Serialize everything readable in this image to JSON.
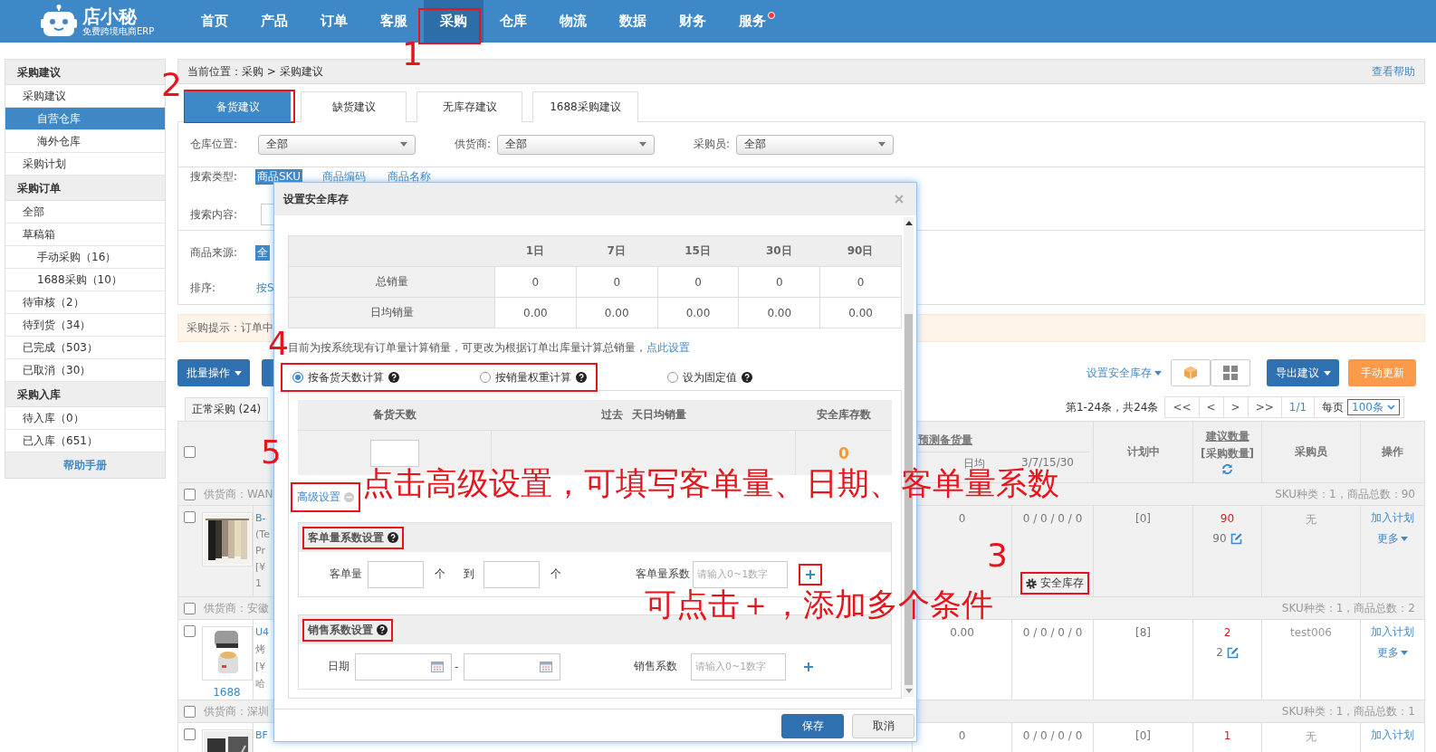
{
  "nav": {
    "logo": "店小秘",
    "tagline": "免费跨境电商ERP",
    "items": [
      {
        "label": "首页",
        "selected": false,
        "badge": false
      },
      {
        "label": "产品",
        "selected": false,
        "badge": false
      },
      {
        "label": "订单",
        "selected": false,
        "badge": false
      },
      {
        "label": "客服",
        "selected": false,
        "badge": false
      },
      {
        "label": "采购",
        "selected": true,
        "badge": false
      },
      {
        "label": "仓库",
        "selected": false,
        "badge": false
      },
      {
        "label": "物流",
        "selected": false,
        "badge": false
      },
      {
        "label": "数据",
        "selected": false,
        "badge": false
      },
      {
        "label": "财务",
        "selected": false,
        "badge": false
      },
      {
        "label": "服务",
        "selected": false,
        "badge": true
      }
    ]
  },
  "sidebar": {
    "sections": [
      {
        "title": "采购建议",
        "items": [
          {
            "label": "采购建议",
            "selected": false,
            "children": [
              {
                "label": "自营仓库",
                "selected": true
              },
              {
                "label": "海外仓库",
                "selected": false
              }
            ]
          },
          {
            "label": "采购计划",
            "selected": false
          }
        ]
      },
      {
        "title": "采购订单",
        "items": [
          {
            "label": "全部",
            "selected": false
          },
          {
            "label": "草稿箱",
            "selected": false,
            "children": [
              {
                "label": "手动采购（16）",
                "selected": false
              },
              {
                "label": "1688采购（10）",
                "selected": false
              }
            ]
          },
          {
            "label": "待审核（2）",
            "selected": false
          },
          {
            "label": "待到货（34）",
            "selected": false
          },
          {
            "label": "已完成（503）",
            "selected": false
          },
          {
            "label": "已取消（30）",
            "selected": false
          }
        ]
      },
      {
        "title": "采购入库",
        "items": [
          {
            "label": "待入库（0）",
            "selected": false
          },
          {
            "label": "已入库（651）",
            "selected": false
          }
        ]
      }
    ],
    "help": "帮助手册"
  },
  "breadcrumb": {
    "text": "当前位置：采购 > 采购建议",
    "help": "查看帮助"
  },
  "tabs": [
    {
      "label": "备货建议",
      "selected": true
    },
    {
      "label": "缺货建议",
      "selected": false
    },
    {
      "label": "无库存建议",
      "selected": false
    },
    {
      "label": "1688采购建议",
      "selected": false
    }
  ],
  "filters": {
    "selects": [
      {
        "label": "仓库位置:",
        "value": "全部"
      },
      {
        "label": "供货商:",
        "value": "全部"
      },
      {
        "label": "采购员:",
        "value": "全部"
      }
    ],
    "search_type": {
      "label": "搜索类型:",
      "options": [
        {
          "label": "商品SKU",
          "selected": true
        },
        {
          "label": "商品编码",
          "selected": false
        },
        {
          "label": "商品名称",
          "selected": false
        }
      ]
    },
    "search_content": {
      "label": "搜索内容:"
    },
    "source": {
      "label": "商品来源:",
      "value": "全"
    },
    "sort": {
      "label": "排序:",
      "value": "按S"
    }
  },
  "tip": "采购提示：订单中",
  "toolbar": {
    "batch": "批量操作",
    "safety_link": "设置安全库存",
    "export": "导出建议",
    "update": "手动更新"
  },
  "list_tabs": [
    {
      "label": "正常采购 (24)",
      "selected": true
    }
  ],
  "pagination": {
    "summary": "第1-24条，共24条",
    "buttons": [
      "<<",
      "<",
      ">",
      ">>"
    ],
    "page": "1/1",
    "per_page_label": "每页",
    "per_page": "100条"
  },
  "table": {
    "header_checked": false,
    "columns": {
      "forecast": "预测备货量",
      "daily": "日均",
      "periods": "3/7/15/30",
      "planned": "计划中",
      "suggested": "建议数量",
      "purchase": "[采购数量]",
      "buyer": "采购员",
      "actions": "操作"
    },
    "groups": [
      {
        "checked": false,
        "supplier": "供货商：WAN",
        "summary": "SKU种类：1，商品总数：90",
        "row": {
          "checked": false,
          "highlighted": true,
          "image": {
            "kind": "picture"
          },
          "product_lines": [
            "B-",
            "(Te",
            "Pr",
            "[¥",
            "1"
          ],
          "daily": "0",
          "periods": "0 / 0 / 0 / 0",
          "safety_button": "安全库存",
          "planned": "[0]",
          "suggested": "90",
          "purchase_qty": "90",
          "buyer": "无",
          "actions": [
            "加入计划",
            "更多"
          ]
        }
      },
      {
        "checked": false,
        "supplier": "供货商：安徽",
        "summary": "SKU种类：1，商品总数：2",
        "row": {
          "checked": false,
          "highlighted": false,
          "image": {
            "kind": "picture"
          },
          "image_caption": "1688",
          "product_lines": [
            "U4",
            "烤",
            "[¥",
            "哈"
          ],
          "daily": "0.00",
          "periods": "0 / 0 / 0 / 0",
          "planned": "[8]",
          "suggested": "2",
          "purchase_qty": "2",
          "buyer": "test006",
          "actions": [
            "加入计划",
            "更多"
          ]
        }
      },
      {
        "checked": false,
        "supplier": "供货商：深圳",
        "summary": "SKU种类：1，商品总数：1",
        "row": {
          "checked": false,
          "highlighted": false,
          "image": {
            "kind": "picture"
          },
          "product_lines": [
            "BF"
          ],
          "daily": "0",
          "periods": "0 / 0 / 0 / 0",
          "planned": "[0]",
          "suggested": "1",
          "buyer": "无",
          "actions": [
            "加入计划"
          ]
        }
      }
    ]
  },
  "dialog": {
    "title": "设置安全库存",
    "sales_table": {
      "columns": [
        "1日",
        "7日",
        "15日",
        "30日",
        "90日"
      ],
      "rows": [
        {
          "label": "总销量",
          "values": [
            "0",
            "0",
            "0",
            "0",
            "0"
          ]
        },
        {
          "label": "日均销量",
          "values": [
            "0.00",
            "0.00",
            "0.00",
            "0.00",
            "0.00"
          ]
        }
      ]
    },
    "note": {
      "text": "目前为按系统现有订单量计算销量，可更改为根据订单出库量计算总销量，",
      "link": "点此设置"
    },
    "methods": [
      {
        "label": "按备货天数计算",
        "selected": true
      },
      {
        "label": "按销量权重计算",
        "selected": false
      },
      {
        "label": "设为固定值",
        "selected": false
      }
    ],
    "calc_table": {
      "days": "备货天数",
      "past": "过去",
      "past_rest": "天日均销量",
      "safety": "安全库存数",
      "result": "0"
    },
    "advanced_link": "高级设置",
    "order_coefficient": {
      "title": "客单量系数设置",
      "qty_label": "客单量",
      "unit": "个",
      "to": "到",
      "unit_end": "个",
      "coef_label": "客单量系数",
      "placeholder": "请输入0~1数字"
    },
    "sales_coefficient": {
      "title": "销售系数设置",
      "date_label": "日期",
      "separator": "-",
      "coef_label": "销售系数",
      "placeholder": "请输入0~1数字"
    },
    "buttons": [
      {
        "label": "保存",
        "kind": "primary"
      },
      {
        "label": "取消",
        "kind": "default"
      }
    ]
  },
  "annotations": {
    "markers": [
      "1",
      "2",
      "3",
      "4",
      "5"
    ],
    "notes": [
      "点击高级设置，可填写客单量、日期、客单量系数",
      "可点击＋，添加多个条件"
    ]
  }
}
